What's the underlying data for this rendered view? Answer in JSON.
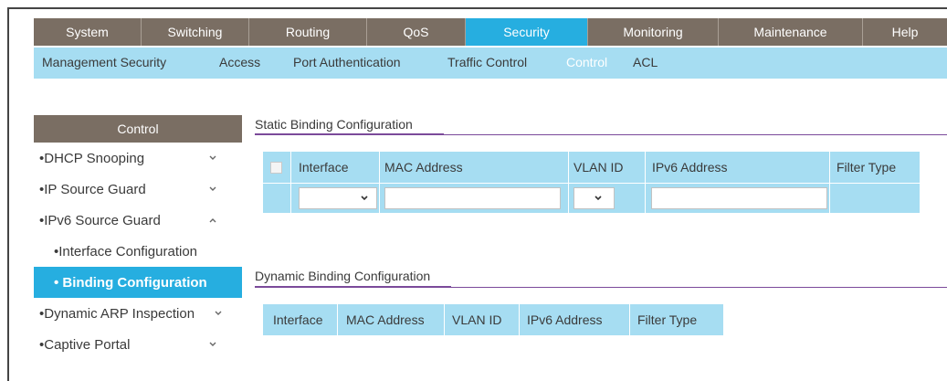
{
  "top_nav": [
    {
      "label": "System",
      "active": false
    },
    {
      "label": "Switching",
      "active": false
    },
    {
      "label": "Routing",
      "active": false
    },
    {
      "label": "QoS",
      "active": false
    },
    {
      "label": "Security",
      "active": true
    },
    {
      "label": "Monitoring",
      "active": false
    },
    {
      "label": "Maintenance",
      "active": false
    },
    {
      "label": "Help",
      "active": false
    }
  ],
  "sub_nav": [
    {
      "label": "Management Security"
    },
    {
      "label": "Access"
    },
    {
      "label": "Port Authentication"
    },
    {
      "label": "Traffic Control"
    },
    {
      "label": "Control",
      "active": true
    },
    {
      "label": "ACL"
    }
  ],
  "sidebar": {
    "header": "Control",
    "items": [
      {
        "label": "•DHCP Snooping",
        "chevron": "down"
      },
      {
        "label": "•IP Source Guard",
        "chevron": "down"
      },
      {
        "label": "•IPv6 Source Guard",
        "chevron": "up"
      },
      {
        "label": "•Interface Configuration",
        "sub": true
      },
      {
        "label": "• Binding Configuration",
        "sub": true,
        "selected": true
      },
      {
        "label": "•Dynamic ARP Inspection",
        "chevron": "down"
      },
      {
        "label": "•Captive Portal",
        "chevron": "down"
      }
    ]
  },
  "static_binding": {
    "title": "Static Binding Configuration",
    "columns": [
      "Interface",
      "MAC Address",
      "VLAN ID",
      "IPv6 Address",
      "Filter Type"
    ]
  },
  "dynamic_binding": {
    "title": "Dynamic Binding Configuration",
    "columns": [
      "Interface",
      "MAC Address",
      "VLAN ID",
      "IPv6 Address",
      "Filter Type"
    ]
  },
  "colors": {
    "nav_bg": "#7a6e63",
    "active_tab": "#26aee0",
    "subnav_bg": "#a6ddf2",
    "section_rule": "#7b4a9a"
  }
}
